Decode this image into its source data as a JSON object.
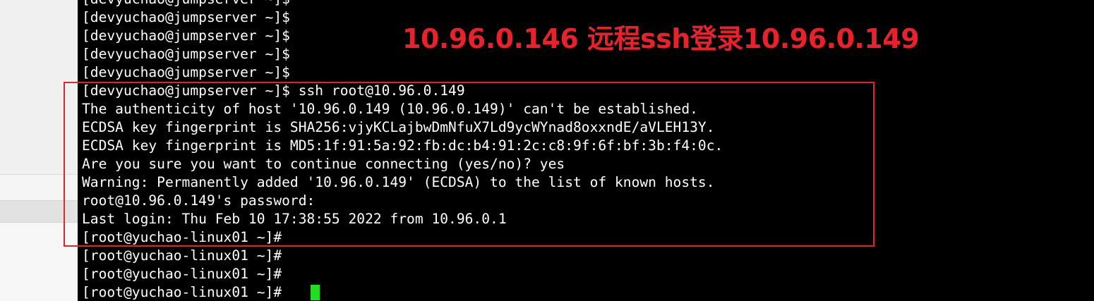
{
  "terminal": {
    "lines": [
      "[devyuchao@jumpserver ~]$",
      "[devyuchao@jumpserver ~]$",
      "[devyuchao@jumpserver ~]$",
      "[devyuchao@jumpserver ~]$",
      "[devyuchao@jumpserver ~]$",
      "[devyuchao@jumpserver ~]$ ssh root@10.96.0.149",
      "The authenticity of host '10.96.0.149 (10.96.0.149)' can't be established.",
      "ECDSA key fingerprint is SHA256:vjyKCLajbwDmNfuX7Ld9ycWYnad8oxxndE/aVLEH13Y.",
      "ECDSA key fingerprint is MD5:1f:91:5a:92:fb:dc:b4:91:2c:c8:9f:6f:bf:3b:f4:0c.",
      "Are you sure you want to continue connecting (yes/no)? yes",
      "Warning: Permanently added '10.96.0.149' (ECDSA) to the list of known hosts.",
      "root@10.96.0.149's password:",
      "Last login: Thu Feb 10 17:38:55 2022 from 10.96.0.1",
      "[root@yuchao-linux01 ~]#",
      "[root@yuchao-linux01 ~]#",
      "[root@yuchao-linux01 ~]#",
      "[root@yuchao-linux01 ~]#"
    ],
    "cursor_color": "#22dd22"
  },
  "annotation": {
    "title": "10.96.0.146 远程ssh登录10.96.0.149",
    "color": "#e8212c"
  }
}
